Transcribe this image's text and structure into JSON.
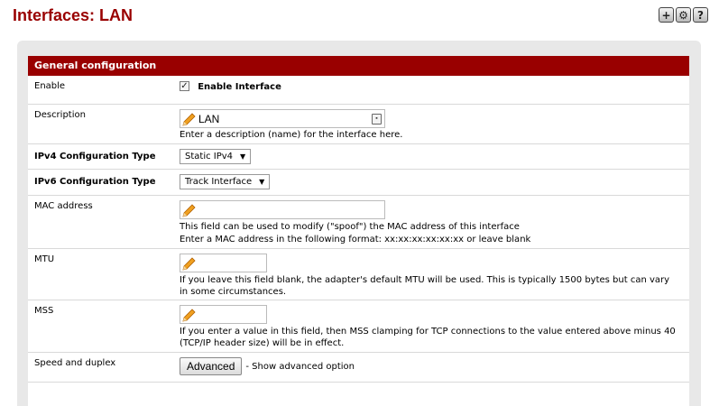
{
  "page": {
    "title": "Interfaces: LAN",
    "icons": [
      "add-icon",
      "settings-icon",
      "help-icon"
    ],
    "icon_glyphs": [
      "+",
      "⚙",
      "?"
    ]
  },
  "section": {
    "header": "General configuration"
  },
  "enable": {
    "label": "Enable",
    "checkbox_label": "Enable Interface",
    "checked": true
  },
  "description": {
    "label": "Description",
    "value": "LAN",
    "help": "Enter a description (name) for the interface here."
  },
  "ipv4": {
    "label": "IPv4 Configuration Type",
    "selected": "Static IPv4"
  },
  "ipv6": {
    "label": "IPv6 Configuration Type",
    "selected": "Track Interface"
  },
  "mac": {
    "label": "MAC address",
    "value": "",
    "help1": "This field can be used to modify (\"spoof\") the MAC address of this interface",
    "help2": "Enter a MAC address in the following format: xx:xx:xx:xx:xx:xx or leave blank"
  },
  "mtu": {
    "label": "MTU",
    "value": "",
    "help": "If you leave this field blank, the adapter's default MTU will be used. This is typically 1500 bytes but can vary in some circumstances."
  },
  "mss": {
    "label": "MSS",
    "value": "",
    "help": "If you enter a value in this field, then MSS clamping for TCP connections to the value entered above minus 40 (TCP/IP header size) will be in effect."
  },
  "speed": {
    "label": "Speed and duplex",
    "button": "Advanced",
    "help": "- Show advanced option"
  },
  "colors": {
    "accent": "#990000",
    "panel": "#e8e8e8"
  }
}
